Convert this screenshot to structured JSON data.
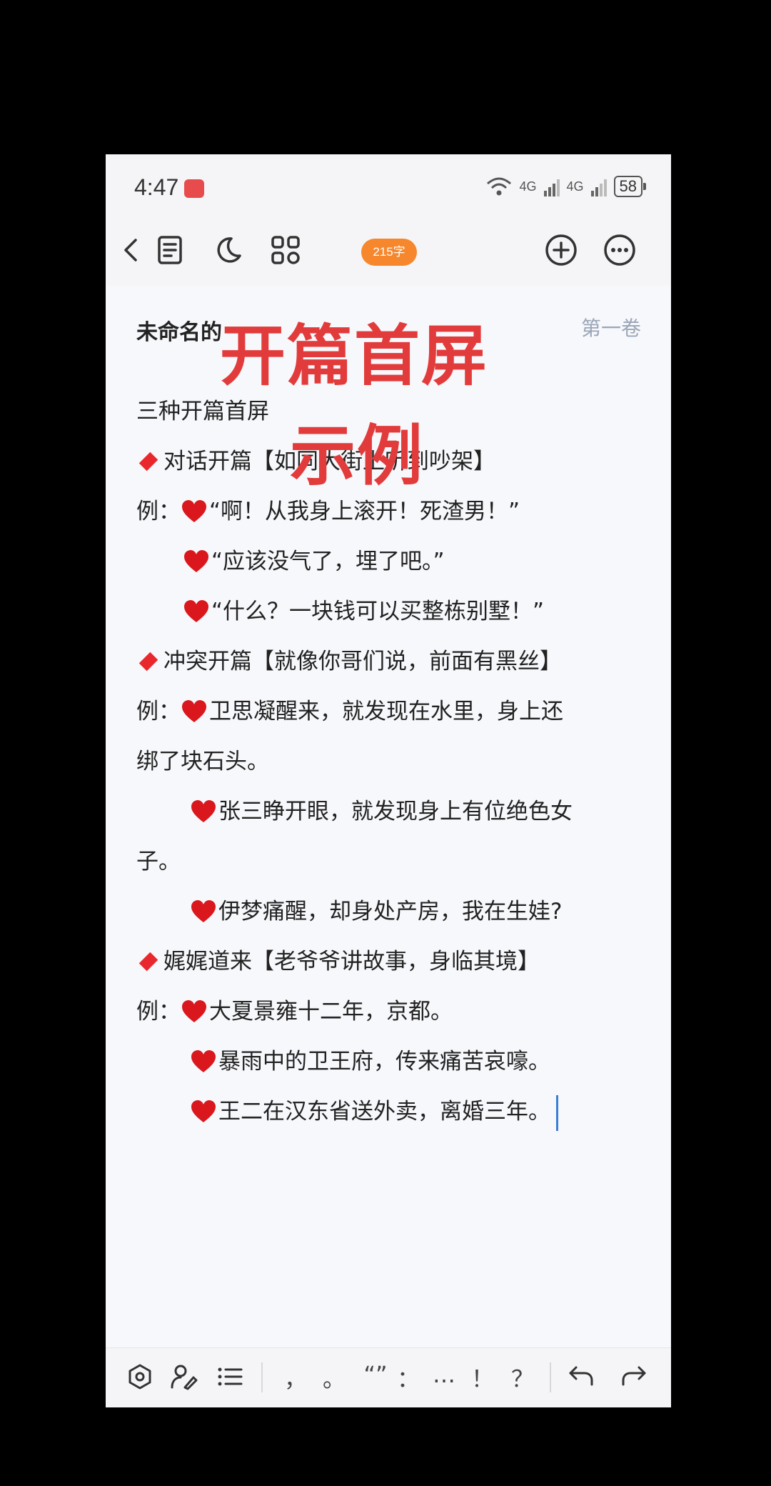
{
  "status_bar": {
    "time": "4:47",
    "battery": "58",
    "network": [
      "4G",
      "4G"
    ]
  },
  "toolbar": {
    "word_count": "215字"
  },
  "doc": {
    "title": "未命名的",
    "volume": "第一卷"
  },
  "overlay": {
    "line1": "开篇首屏",
    "line2": "示例"
  },
  "lines": [
    "三种开篇首屏",
    "对话开篇【如同大街上听到吵架】",
    "例：",
    "“啊！从我身上滚开！死渣男！”",
    "“应该没气了，埋了吧。”",
    "“什么？一块钱可以买整栋别墅！”",
    "冲突开篇【就像你哥们说，前面有黑丝】",
    "例：",
    "卫思凝醒来，就发现在水里，身上还",
    "绑了块石头。",
    "张三睁开眼，就发现身上有位绝色女",
    "子。",
    "伊梦痛醒，却身处产房，我在生娃?",
    "娓娓道来【老爷爷讲故事，身临其境】",
    "例：",
    "大夏景雍十二年，京都。",
    "暴雨中的卫王府，传来痛苦哀嚎。",
    "王二在汉东省送外卖，离婚三年。"
  ],
  "punctuation": [
    "，",
    "。",
    "“”",
    "：",
    "…",
    "！",
    "？"
  ],
  "colors": {
    "accent": "#f6872c",
    "diamond": "#e8282c",
    "heart": "#d9171c",
    "overlay": "#e23b3b",
    "cursor": "#3b7fd4"
  },
  "icons": [
    "back-icon",
    "outline-icon",
    "night-mode-icon",
    "grid-icon",
    "add-icon",
    "more-icon",
    "settings-icon",
    "handwrite-icon",
    "list-icon",
    "undo-icon",
    "redo-icon"
  ]
}
